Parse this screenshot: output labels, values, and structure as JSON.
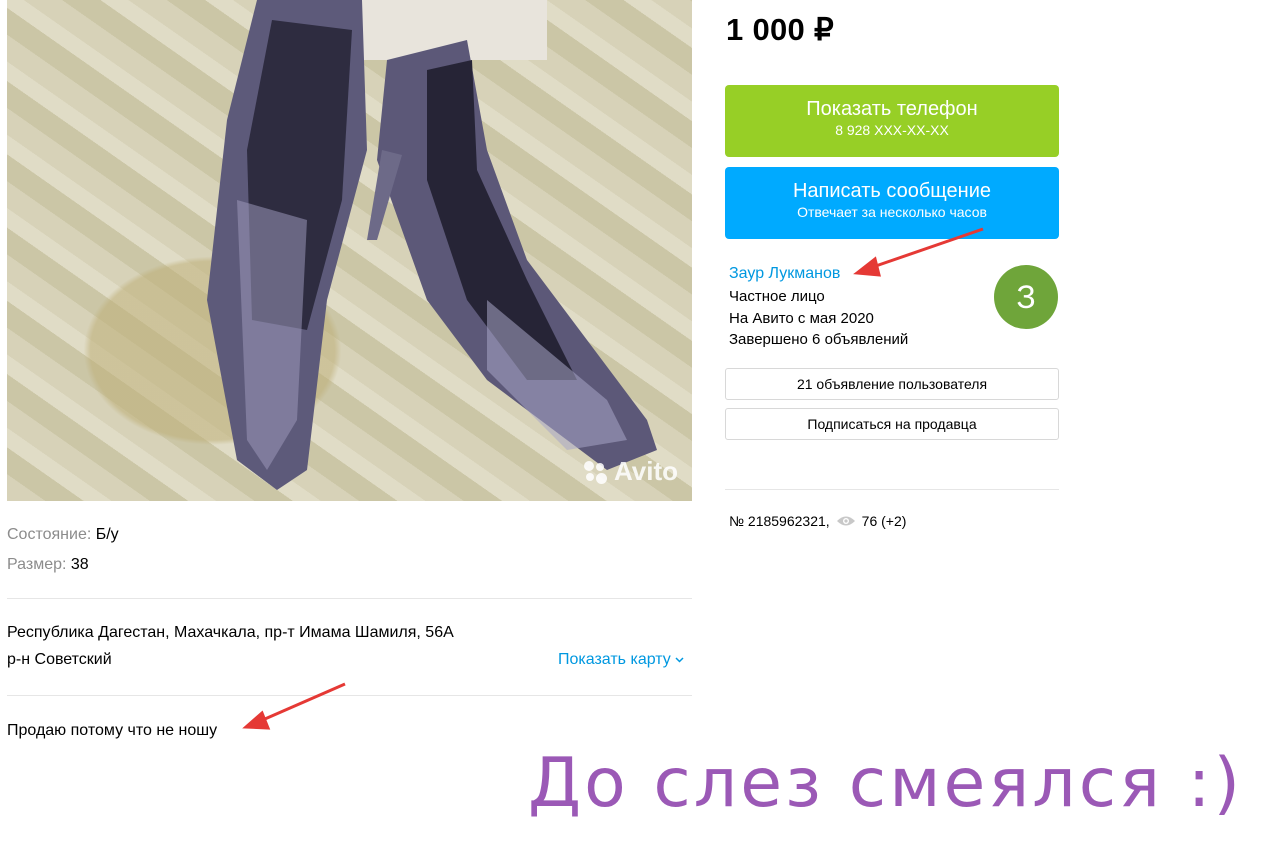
{
  "photo": {
    "alt": "metallic purple high-heel shoes",
    "watermark": "Avito"
  },
  "params": [
    {
      "label": "Состояние:",
      "value": "Б/у"
    },
    {
      "label": "Размер:",
      "value": "38"
    }
  ],
  "address": {
    "line1": "Республика Дагестан, Махачкала, пр-т Имама Шамиля, 56А",
    "line2": "р-н Советский",
    "map_link": "Показать карту"
  },
  "description": "Продаю потому что не ношу",
  "price": "1 000 ₽",
  "buttons": {
    "phone_title": "Показать телефон",
    "phone_number": "8 928 XXX-XX-XX",
    "message_title": "Написать сообщение",
    "message_sub": "Отвечает за несколько часов"
  },
  "seller": {
    "name": "Заур Лукманов",
    "type": "Частное лицо",
    "since": "На Авито с мая 2020",
    "completed": "Завершено 6 объявлений",
    "avatar_letter": "З",
    "avatar_color": "#6fa53a"
  },
  "seller_actions": {
    "ads": "21 объявление пользователя",
    "subscribe": "Подписаться на продавца"
  },
  "listing": {
    "number": "№ 2185962321,",
    "views": "76 (+2)"
  },
  "caption": "До слез смеялся :)",
  "colors": {
    "green_button": "#97cf26",
    "blue_button": "#00aaff",
    "link": "#0098e0",
    "arrow": "#e53935",
    "caption": "#9b59b6"
  }
}
